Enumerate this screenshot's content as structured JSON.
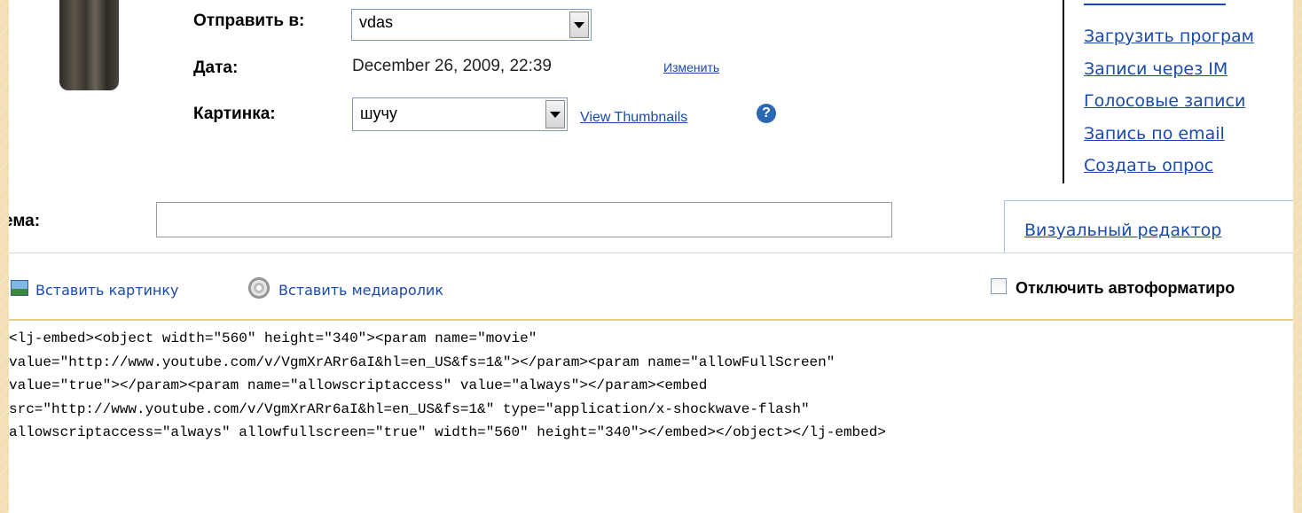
{
  "form": {
    "send_to_label": "Отправить в:",
    "send_to_value": "vdas",
    "date_label": "Дата:",
    "date_value": "December 26, 2009, 22:39",
    "date_change_link": "Изменить",
    "picture_label": "Картинка:",
    "picture_value": "шучу",
    "view_thumbnails_link": "View Thumbnails",
    "help_icon": "?",
    "subject_label": "ема:",
    "subject_value": ""
  },
  "side_menu": {
    "items": [
      "Загрузить програм",
      "Записи через IM",
      "Голосовые записи",
      "Запись по email",
      "Создать опрос"
    ]
  },
  "editor_tab": {
    "visual_editor_link": "Визуальный редактор"
  },
  "toolbar": {
    "insert_image": "Вставить картинку",
    "insert_media": "Вставить медиаролик",
    "disable_autoformat_label": "Отключить автоформатиро",
    "disable_autoformat_checked": false
  },
  "editor": {
    "lines": [
      "<lj-embed><object width=\"560\" height=\"340\"><param name=\"movie\"",
      "value=\"http://www.youtube.com/v/VgmXrARr6aI&hl=en_US&fs=1&\"></param><param name=\"allowFullScreen\"",
      "value=\"true\"></param><param name=\"allowscriptaccess\" value=\"always\"></param><embed",
      "src=\"http://www.youtube.com/v/VgmXrARr6aI&hl=en_US&fs=1&\" type=\"application/x-shockwave-flash\"",
      "allowscriptaccess=\"always\" allowfullscreen=\"true\" width=\"560\" height=\"340\"></embed></object></lj-embed>"
    ]
  },
  "icons": {
    "insert_image": "image-icon",
    "insert_media": "media-disc-icon",
    "help": "help-icon"
  }
}
